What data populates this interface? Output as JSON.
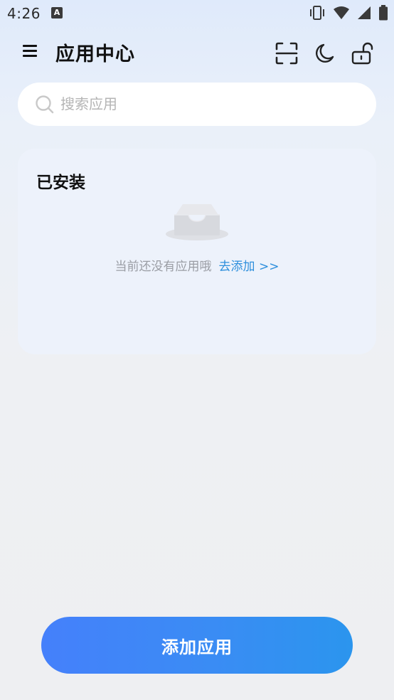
{
  "status_bar": {
    "time": "4:26",
    "notification_icon_letter": "A",
    "icons": [
      "vibrate-icon",
      "wifi-icon",
      "signal-icon",
      "battery-icon"
    ]
  },
  "header": {
    "title": "应用中心",
    "icons": [
      "menu-icon",
      "scan-icon",
      "moon-icon",
      "unlock-icon"
    ]
  },
  "search": {
    "placeholder": "搜索应用",
    "value": ""
  },
  "installed": {
    "title": "已安装",
    "empty_text": "当前还没有应用哦",
    "add_link": "去添加 >>"
  },
  "bottom": {
    "add_button_label": "添加应用"
  },
  "colors": {
    "accent": "#4580fb",
    "link": "#2e8fdc",
    "card_bg": "#edf2fb"
  }
}
